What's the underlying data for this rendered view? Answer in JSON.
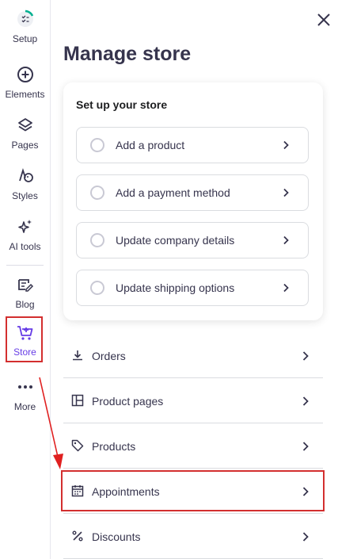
{
  "rail": {
    "items": [
      {
        "label": "Setup",
        "icon": "setup-progress-icon"
      },
      {
        "label": "Elements",
        "icon": "plus-circle-icon"
      },
      {
        "label": "Pages",
        "icon": "layers-icon"
      },
      {
        "label": "Styles",
        "icon": "palette-icon"
      },
      {
        "label": "AI tools",
        "icon": "sparkles-icon"
      },
      {
        "label": "Blog",
        "icon": "edit-icon"
      },
      {
        "label": "Store",
        "icon": "cart-icon"
      },
      {
        "label": "More",
        "icon": "more-dots-icon"
      }
    ],
    "active": "Store"
  },
  "panel": {
    "title": "Manage store",
    "close_icon": "close-icon"
  },
  "setup_card": {
    "title": "Set up your store",
    "tasks": [
      {
        "label": "Add a product"
      },
      {
        "label": "Add a payment method"
      },
      {
        "label": "Update company details"
      },
      {
        "label": "Update shipping options"
      }
    ]
  },
  "menu": [
    {
      "label": "Orders",
      "icon": "download-icon"
    },
    {
      "label": "Product pages",
      "icon": "layout-icon"
    },
    {
      "label": "Products",
      "icon": "tag-icon"
    },
    {
      "label": "Appointments",
      "icon": "calendar-icon"
    },
    {
      "label": "Discounts",
      "icon": "percent-icon"
    }
  ],
  "colors": {
    "accent": "#673de6",
    "highlight": "#d32f2f",
    "text": "#36344d"
  }
}
